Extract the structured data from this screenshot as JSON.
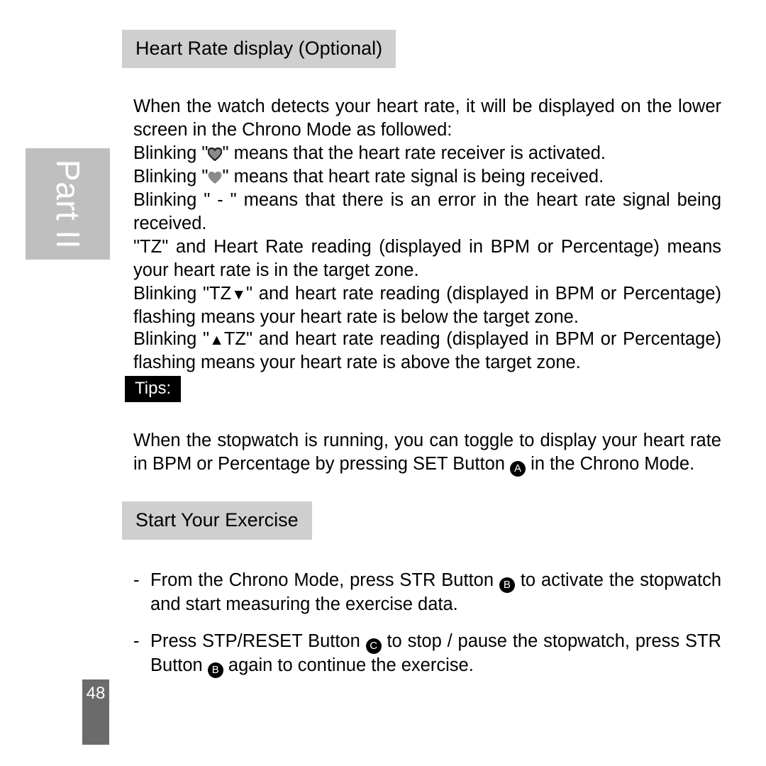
{
  "page": {
    "number": "48",
    "part_label": "Part II",
    "background": "#ffffff",
    "heading_bar_color": "#cfcfcf",
    "tips_badge_color": "#000000",
    "part_tab_color": "#bfbfbf",
    "page_number_box_color": "#6b6b6b"
  },
  "sections": {
    "heart_rate": {
      "heading": "Heart Rate display (Optional)",
      "intro": "When the watch detects your heart rate, it will be displayed on the lower screen in the Chrono Mode as followed:",
      "blink_outline_heart_pre": "Blinking \"",
      "blink_outline_heart_post": "\" means that the heart rate receiver is activated.",
      "blink_solid_heart_pre": "Blinking \"",
      "blink_solid_heart_post": "\" means that heart rate signal is being received.",
      "blink_error": "Blinking \" - \" means that there is an error in the heart rate signal being received.",
      "target_zone": "\"TZ\" and Heart Rate reading (displayed in BPM or Percentage) means your heart rate is in the target zone.",
      "below_zone_pre": "Blinking \"TZ",
      "below_zone_post": "\" and heart rate reading (displayed in BPM or Percentage) flashing means your heart rate is below the target zone.",
      "above_zone_pre": "Blinking \"",
      "above_zone_mid": "TZ\" and heart rate reading (displayed in BPM or Percentage) flashing means your heart rate is above the target zone.",
      "down_triangle": "▼",
      "up_triangle": "▲"
    },
    "tips": {
      "badge": "Tips:",
      "body_before_button": "When the stopwatch is running, you can toggle to display your heart rate in BPM or Percentage by pressing SET Button ",
      "button_label": "A",
      "body_after_button": " in the Chrono Mode."
    },
    "start_exercise": {
      "heading": "Start Your Exercise",
      "bullets": [
        {
          "dash": "-",
          "before_button": "From the Chrono Mode, press STR Button ",
          "button_label": "B",
          "after_button": " to activate the stopwatch and start measuring the exercise data."
        },
        {
          "dash": "-",
          "before_button": "Press STP/RESET Button ",
          "button_label": "C",
          "mid_text": " to stop / pause the stopwatch, press STR Button ",
          "button_label_2": "B",
          "after_button": " again to continue the exercise."
        }
      ]
    }
  }
}
